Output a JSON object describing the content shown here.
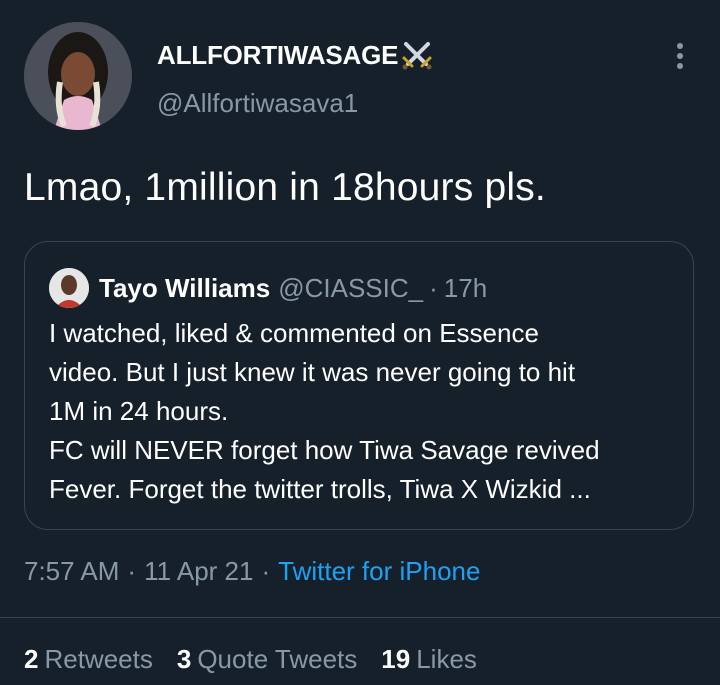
{
  "author": {
    "display_name": "ALLFORTIWASAGE",
    "handle": "@Allfortiwasava1",
    "name_emoji_icon": "crossed-swords-icon"
  },
  "tweet": {
    "text": "Lmao, 1million in 18hours pls."
  },
  "quoted_tweet": {
    "name": "Tayo Williams",
    "handle": "@CIASSIC_",
    "separator": "·",
    "time": "17h",
    "lines": [
      "I watched, liked & commented on Essence",
      "video. But I just knew it was never going to hit",
      "1M in 24 hours.",
      "FC will NEVER forget how Tiwa Savage revived",
      "Fever. Forget the twitter trolls, Tiwa X Wizkid ..."
    ]
  },
  "meta": {
    "time": "7:57 AM",
    "separator": "·",
    "date": "11 Apr 21",
    "source": "Twitter for iPhone"
  },
  "stats": {
    "retweets_count": "2",
    "retweets_label": "Retweets",
    "quotes_count": "3",
    "quotes_label": "Quote Tweets",
    "likes_count": "19",
    "likes_label": "Likes"
  },
  "colors": {
    "background": "#15202b",
    "secondary_text": "#8899a6",
    "link": "#1da1f2",
    "border": "#38444d"
  }
}
